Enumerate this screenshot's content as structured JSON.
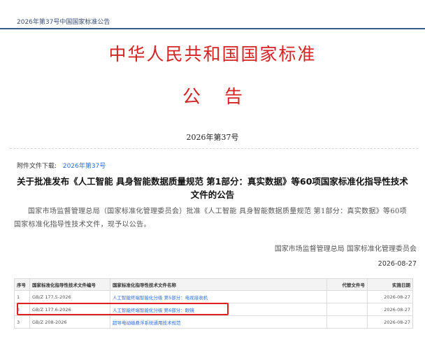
{
  "header": {
    "breadcrumb": "2026年第37号中国国家标准公告"
  },
  "announcement": {
    "main_title": "中华人民共和国国家标准",
    "sub_title_1": "公",
    "sub_title_2": "告",
    "bulletin_number": "2026年第37号"
  },
  "attachment": {
    "label": "附件文件下载:",
    "link": "2026年第37号"
  },
  "notice": {
    "title": "关于批准发布《人工智能 具身智能数据质量规范 第1部分：真实数据》等60项国家标准化指导性技术文件的公告",
    "body": "国家市场监督管理总局（国家标准化管理委员会）批准《人工智能 具身智能数据质量规范 第1部分：真实数据》等60项国家标准化指导性技术文件，现予以公告。",
    "signer": "国家市场监督管理总局 国家标准化管理委员会",
    "date": "2026-08-27"
  },
  "table": {
    "headers": {
      "seq": "序号",
      "code": "国家标准化指导性技术文件编号",
      "name": "国家标准化指导性技术文件名称",
      "replaced": "代替文件号",
      "impl_date": "实施日期"
    },
    "rows": [
      {
        "seq": "1",
        "code": "GB/Z 177.5-2026",
        "name": "人工智能终端智能化分级 第5部分：电视接收机",
        "replaced": "",
        "impl_date": "2026-08-27"
      },
      {
        "seq": "2",
        "code": "GB/Z 177.6-2026",
        "name": "人工智能终端智能化分级 第6部分：眼镜",
        "replaced": "",
        "impl_date": "2026-08-27"
      },
      {
        "seq": "3",
        "code": "GB/Z 208-2026",
        "name": "超导电动磁悬浮系统通用技术规范",
        "replaced": "",
        "impl_date": "2026-08-27"
      }
    ]
  },
  "colors": {
    "title_red": "#d42424",
    "link_blue": "#2c6fd6",
    "highlight_red": "#e02020"
  }
}
